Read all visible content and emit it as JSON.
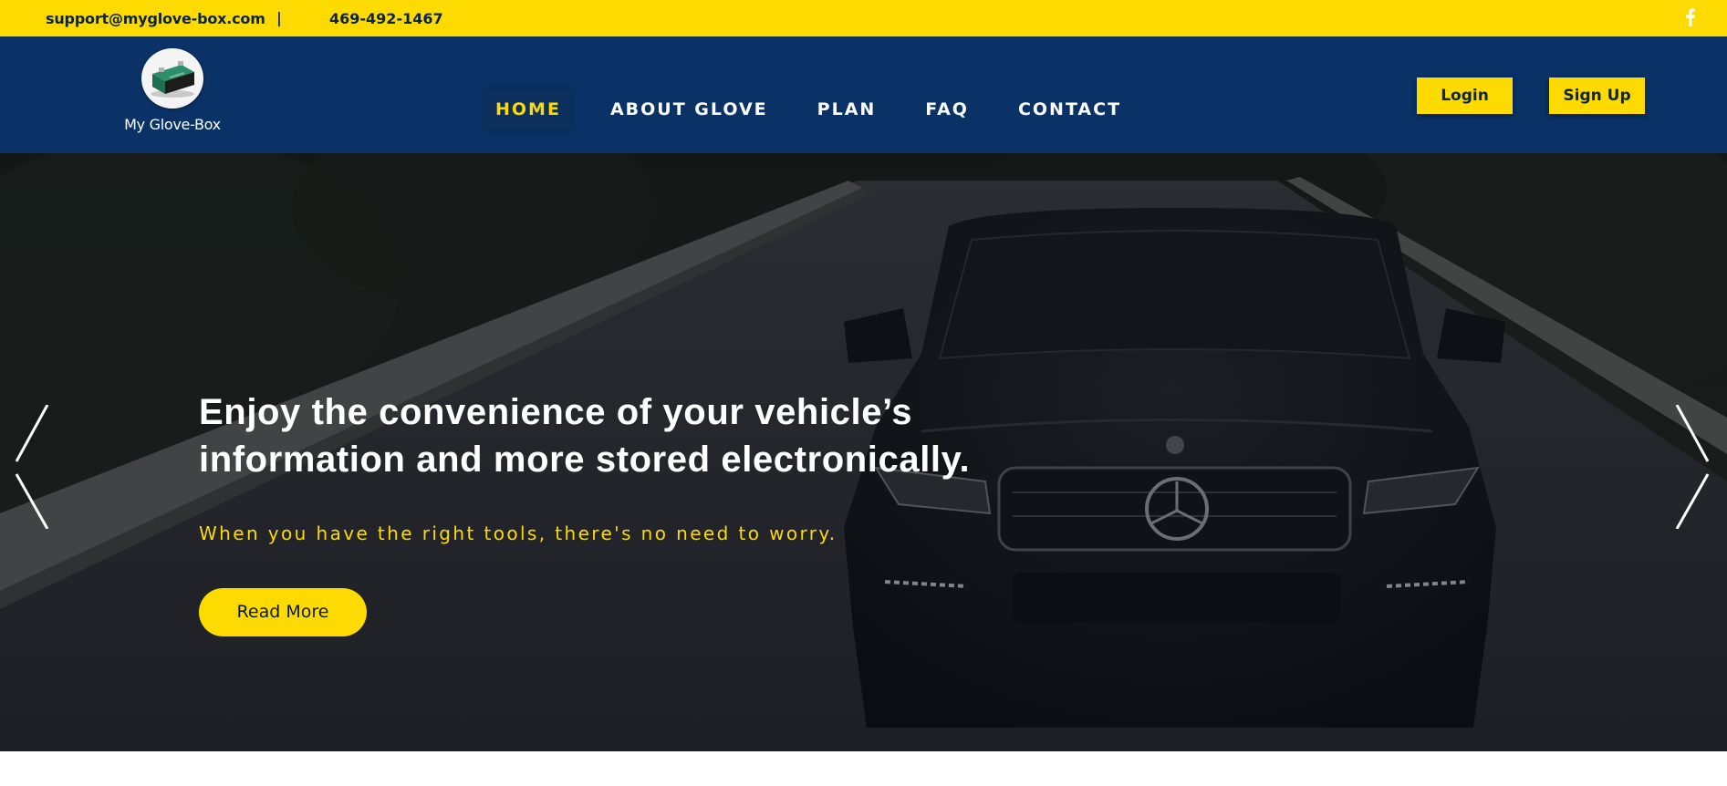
{
  "topbar": {
    "email": "support@myglove-box.com",
    "separator": "|",
    "phone": "469-492-1467",
    "social_icon": "facebook-icon"
  },
  "header": {
    "logo_caption": "My Glove-Box",
    "logo_icon": "car-battery-icon",
    "nav": [
      {
        "label": "HOME",
        "active": true
      },
      {
        "label": "ABOUT GLOVE",
        "active": false
      },
      {
        "label": "PLAN",
        "active": false
      },
      {
        "label": "FAQ",
        "active": false
      },
      {
        "label": "CONTACT",
        "active": false
      }
    ],
    "login_label": "Login",
    "signup_label": "Sign Up"
  },
  "hero": {
    "title_line1": "Enjoy the convenience of your vehicle’s",
    "title_line2": "information and more stored electronically.",
    "subtitle": "When you have the right tools, there's no need to worry.",
    "cta_label": "Read More",
    "prev_icon": "chevron-left-icon",
    "next_icon": "chevron-right-icon"
  },
  "colors": {
    "accent_yellow": "#FDDA00",
    "nav_blue": "#0a3266",
    "text_dark": "#0b2346"
  }
}
